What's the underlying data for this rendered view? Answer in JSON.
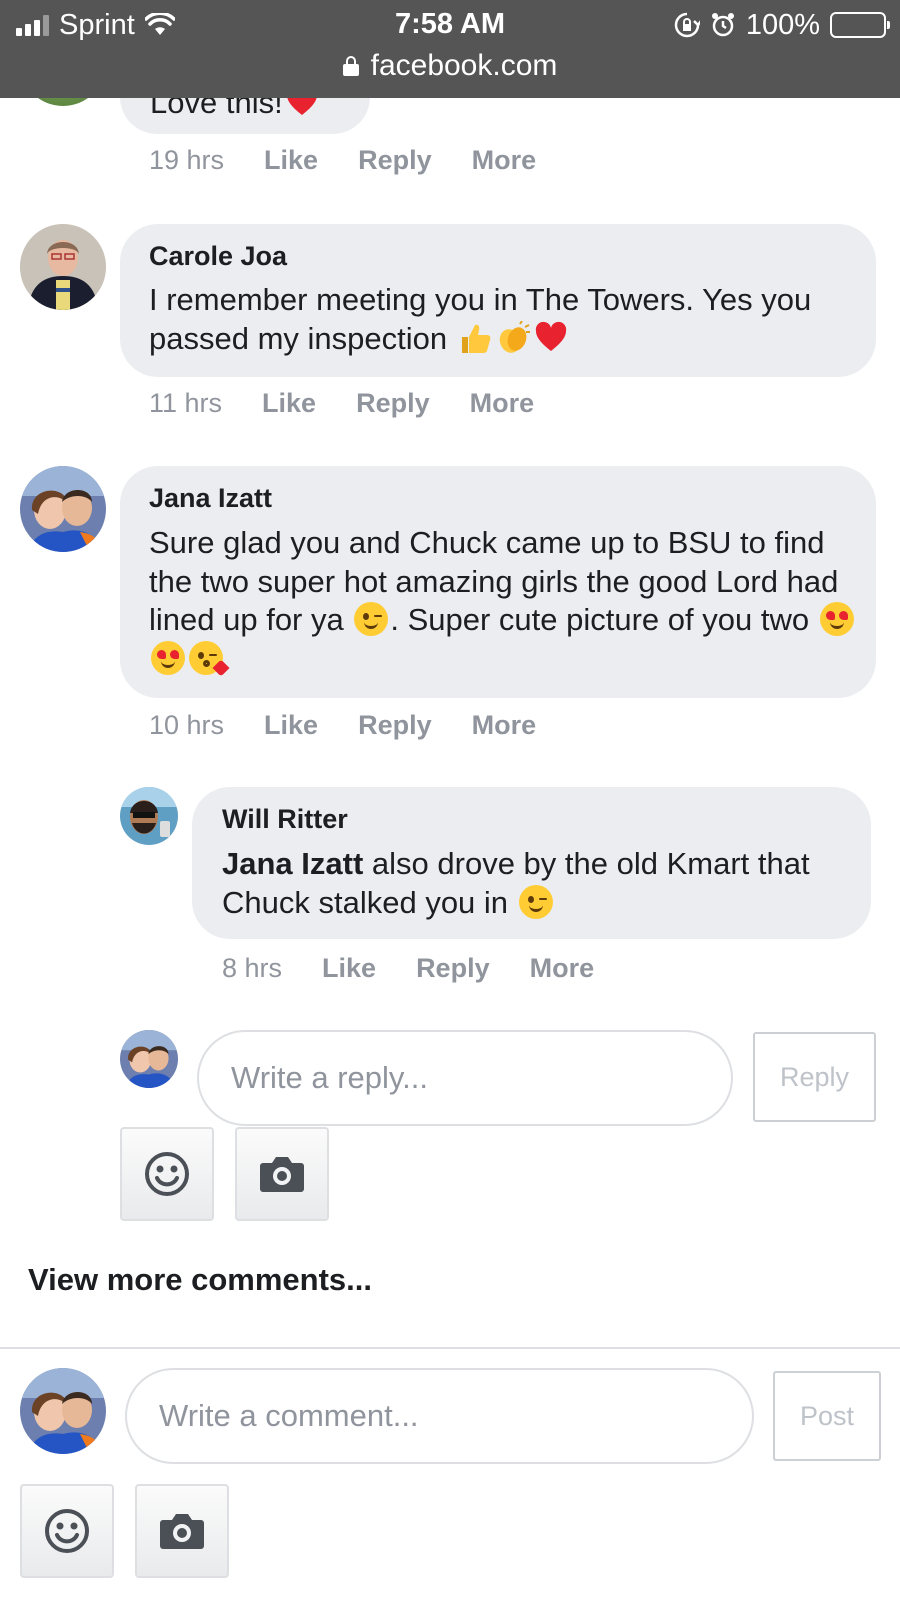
{
  "status_bar": {
    "carrier": "Sprint",
    "time": "7:58 AM",
    "battery": "100%",
    "url": "facebook.com"
  },
  "comments": [
    {
      "author": "",
      "text": "Love this!",
      "time": "19 hrs",
      "actions": [
        "Like",
        "Reply",
        "More"
      ]
    },
    {
      "author": "Carole Joa",
      "text": "I remember meeting you in The Towers. Yes you passed my inspection",
      "emojis": [
        "thumbs-up",
        "clapping-hands",
        "red-heart"
      ],
      "time": "11 hrs",
      "actions": [
        "Like",
        "Reply",
        "More"
      ]
    },
    {
      "author": "Jana Izatt",
      "text_part1": "Sure glad you and Chuck came up to BSU to find the two super hot amazing girls the good Lord had lined up for ya",
      "text_part2": ". Super cute picture of you two",
      "emojis": [
        "winking-face",
        "heart-eyes",
        "heart-eyes",
        "face-blowing-kiss"
      ],
      "time": "10 hrs",
      "actions": [
        "Like",
        "Reply",
        "More"
      ]
    }
  ],
  "reply": {
    "author": "Will Ritter",
    "mention": "Jana Izatt",
    "text": "also drove by the old Kmart that Chuck stalked you in",
    "emoji": "winking-face",
    "time": "8 hrs",
    "actions": [
      "Like",
      "Reply",
      "More"
    ]
  },
  "reply_box": {
    "placeholder": "Write a reply...",
    "button": "Reply"
  },
  "view_more": "View more comments...",
  "comment_box": {
    "placeholder": "Write a comment...",
    "button": "Post"
  },
  "icons": {
    "emoji_button": "smiley-icon",
    "photo_button": "camera-icon"
  },
  "colors": {
    "bubble": "#ebedf0",
    "meta_text": "#90949c",
    "status_bar": "#555555",
    "icon": "#4b4f56"
  }
}
